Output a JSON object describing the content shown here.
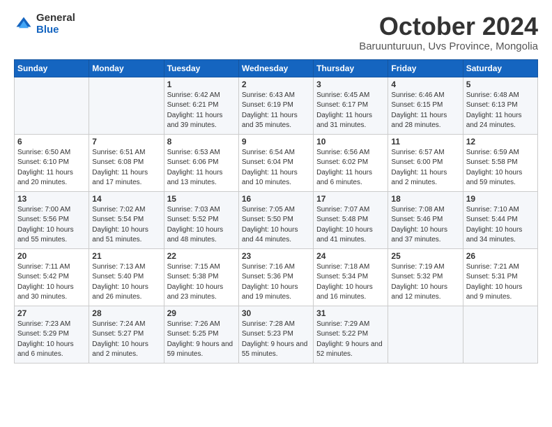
{
  "logo": {
    "general": "General",
    "blue": "Blue"
  },
  "title": "October 2024",
  "location": "Baruunturuun, Uvs Province, Mongolia",
  "days_of_week": [
    "Sunday",
    "Monday",
    "Tuesday",
    "Wednesday",
    "Thursday",
    "Friday",
    "Saturday"
  ],
  "weeks": [
    [
      {
        "day": "",
        "info": ""
      },
      {
        "day": "",
        "info": ""
      },
      {
        "day": "1",
        "info": "Sunrise: 6:42 AM\nSunset: 6:21 PM\nDaylight: 11 hours and 39 minutes."
      },
      {
        "day": "2",
        "info": "Sunrise: 6:43 AM\nSunset: 6:19 PM\nDaylight: 11 hours and 35 minutes."
      },
      {
        "day": "3",
        "info": "Sunrise: 6:45 AM\nSunset: 6:17 PM\nDaylight: 11 hours and 31 minutes."
      },
      {
        "day": "4",
        "info": "Sunrise: 6:46 AM\nSunset: 6:15 PM\nDaylight: 11 hours and 28 minutes."
      },
      {
        "day": "5",
        "info": "Sunrise: 6:48 AM\nSunset: 6:13 PM\nDaylight: 11 hours and 24 minutes."
      }
    ],
    [
      {
        "day": "6",
        "info": "Sunrise: 6:50 AM\nSunset: 6:10 PM\nDaylight: 11 hours and 20 minutes."
      },
      {
        "day": "7",
        "info": "Sunrise: 6:51 AM\nSunset: 6:08 PM\nDaylight: 11 hours and 17 minutes."
      },
      {
        "day": "8",
        "info": "Sunrise: 6:53 AM\nSunset: 6:06 PM\nDaylight: 11 hours and 13 minutes."
      },
      {
        "day": "9",
        "info": "Sunrise: 6:54 AM\nSunset: 6:04 PM\nDaylight: 11 hours and 10 minutes."
      },
      {
        "day": "10",
        "info": "Sunrise: 6:56 AM\nSunset: 6:02 PM\nDaylight: 11 hours and 6 minutes."
      },
      {
        "day": "11",
        "info": "Sunrise: 6:57 AM\nSunset: 6:00 PM\nDaylight: 11 hours and 2 minutes."
      },
      {
        "day": "12",
        "info": "Sunrise: 6:59 AM\nSunset: 5:58 PM\nDaylight: 10 hours and 59 minutes."
      }
    ],
    [
      {
        "day": "13",
        "info": "Sunrise: 7:00 AM\nSunset: 5:56 PM\nDaylight: 10 hours and 55 minutes."
      },
      {
        "day": "14",
        "info": "Sunrise: 7:02 AM\nSunset: 5:54 PM\nDaylight: 10 hours and 51 minutes."
      },
      {
        "day": "15",
        "info": "Sunrise: 7:03 AM\nSunset: 5:52 PM\nDaylight: 10 hours and 48 minutes."
      },
      {
        "day": "16",
        "info": "Sunrise: 7:05 AM\nSunset: 5:50 PM\nDaylight: 10 hours and 44 minutes."
      },
      {
        "day": "17",
        "info": "Sunrise: 7:07 AM\nSunset: 5:48 PM\nDaylight: 10 hours and 41 minutes."
      },
      {
        "day": "18",
        "info": "Sunrise: 7:08 AM\nSunset: 5:46 PM\nDaylight: 10 hours and 37 minutes."
      },
      {
        "day": "19",
        "info": "Sunrise: 7:10 AM\nSunset: 5:44 PM\nDaylight: 10 hours and 34 minutes."
      }
    ],
    [
      {
        "day": "20",
        "info": "Sunrise: 7:11 AM\nSunset: 5:42 PM\nDaylight: 10 hours and 30 minutes."
      },
      {
        "day": "21",
        "info": "Sunrise: 7:13 AM\nSunset: 5:40 PM\nDaylight: 10 hours and 26 minutes."
      },
      {
        "day": "22",
        "info": "Sunrise: 7:15 AM\nSunset: 5:38 PM\nDaylight: 10 hours and 23 minutes."
      },
      {
        "day": "23",
        "info": "Sunrise: 7:16 AM\nSunset: 5:36 PM\nDaylight: 10 hours and 19 minutes."
      },
      {
        "day": "24",
        "info": "Sunrise: 7:18 AM\nSunset: 5:34 PM\nDaylight: 10 hours and 16 minutes."
      },
      {
        "day": "25",
        "info": "Sunrise: 7:19 AM\nSunset: 5:32 PM\nDaylight: 10 hours and 12 minutes."
      },
      {
        "day": "26",
        "info": "Sunrise: 7:21 AM\nSunset: 5:31 PM\nDaylight: 10 hours and 9 minutes."
      }
    ],
    [
      {
        "day": "27",
        "info": "Sunrise: 7:23 AM\nSunset: 5:29 PM\nDaylight: 10 hours and 6 minutes."
      },
      {
        "day": "28",
        "info": "Sunrise: 7:24 AM\nSunset: 5:27 PM\nDaylight: 10 hours and 2 minutes."
      },
      {
        "day": "29",
        "info": "Sunrise: 7:26 AM\nSunset: 5:25 PM\nDaylight: 9 hours and 59 minutes."
      },
      {
        "day": "30",
        "info": "Sunrise: 7:28 AM\nSunset: 5:23 PM\nDaylight: 9 hours and 55 minutes."
      },
      {
        "day": "31",
        "info": "Sunrise: 7:29 AM\nSunset: 5:22 PM\nDaylight: 9 hours and 52 minutes."
      },
      {
        "day": "",
        "info": ""
      },
      {
        "day": "",
        "info": ""
      }
    ]
  ]
}
